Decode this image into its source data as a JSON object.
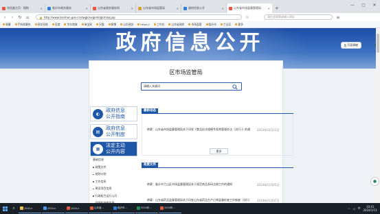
{
  "browser": {
    "tabs": [
      {
        "label": "浏览器主页 · 搜狗",
        "color": "#e5573f"
      },
      {
        "label": "临沂市政务服务",
        "color": "#2f7fd8"
      },
      {
        "label": "山东省政务服务网",
        "color": "#e5573f"
      },
      {
        "label": "山东省市场监管局",
        "color": "#d9a22e"
      },
      {
        "label": "政府信息公开",
        "color": "#2f7fd8"
      },
      {
        "label": "山东省市场监督管理局",
        "color": "#e5573f",
        "active": true
      }
    ],
    "new_tab": "+",
    "window_controls": [
      "—",
      "▢",
      "✕"
    ],
    "url": "http://www.lanshan.gov.cn/zwgk/xxgkml/gkmlxq.jsp",
    "search_placeholder": "请在此搜索或输入网址",
    "bookmarks": [
      "收藏",
      "手机收藏夹",
      "网址导航",
      "百度",
      "京东商城",
      "淘宝网",
      "天猫",
      "微博",
      "山东政务",
      "https://",
      "工作台",
      "山东省政府",
      "市场监管",
      "临沂市",
      "兰山区",
      "更多"
    ]
  },
  "banner": {
    "title": "政府信息公开"
  },
  "share_button": "页面捐献",
  "side_close": "✕",
  "panel_title": "区市场监管局",
  "search": {
    "placeholder": "请输入关键词"
  },
  "left_nav": [
    {
      "label_line1": "政府信息",
      "label_line2": "公开指南",
      "icon": "◐"
    },
    {
      "label_line1": "政府信息",
      "label_line2": "公开制度",
      "icon": "▤"
    },
    {
      "label_line1": "法定主动",
      "label_line2": "公开内容",
      "icon": "▦",
      "active": true
    }
  ],
  "sub_items": [
    "基础信息",
    "政策文件",
    "规划计划",
    "工作信息",
    "建设项目信息",
    "行政权力运行公开",
    "双随机抽查信息"
  ],
  "sections": {
    "news_title": "最新动态",
    "news": [
      {
        "title": "转载：山东省市场监督管理局关于印发《食品执法规模专家库管理办法（试行）》的通知",
        "date": "2023年03月22日"
      }
    ],
    "more_label": "更多",
    "policy_title": "政策文件",
    "policy": [
      {
        "title": "转载：临沂市兰山区市场监督管理局关于规范商品条码注册工作的通知",
        "date": "2024年01月05日"
      },
      {
        "title": "转载：山东省药品监督管理局关于印发山东省药品生产日常监督检查工作制度（试行）的通知",
        "date": "2019年01月07日"
      }
    ]
  },
  "taskbar": {
    "apps": [
      {
        "label": "2024-n",
        "color": "#f0c04a"
      },
      {
        "label": "2024-n",
        "color": "#4a9cf0"
      },
      {
        "label": "2024-n",
        "color": "#e5573f"
      },
      {
        "label": "山东省…",
        "color": "#e5573f"
      },
      {
        "label": "临沂市…",
        "color": "#2f7fd8"
      },
      {
        "label": "2024年…",
        "color": "#2a8a5c"
      },
      {
        "label": "2024年…",
        "color": "#e5573f"
      }
    ],
    "time": "10:41",
    "date": "2024/1/11",
    "lang": "中"
  }
}
